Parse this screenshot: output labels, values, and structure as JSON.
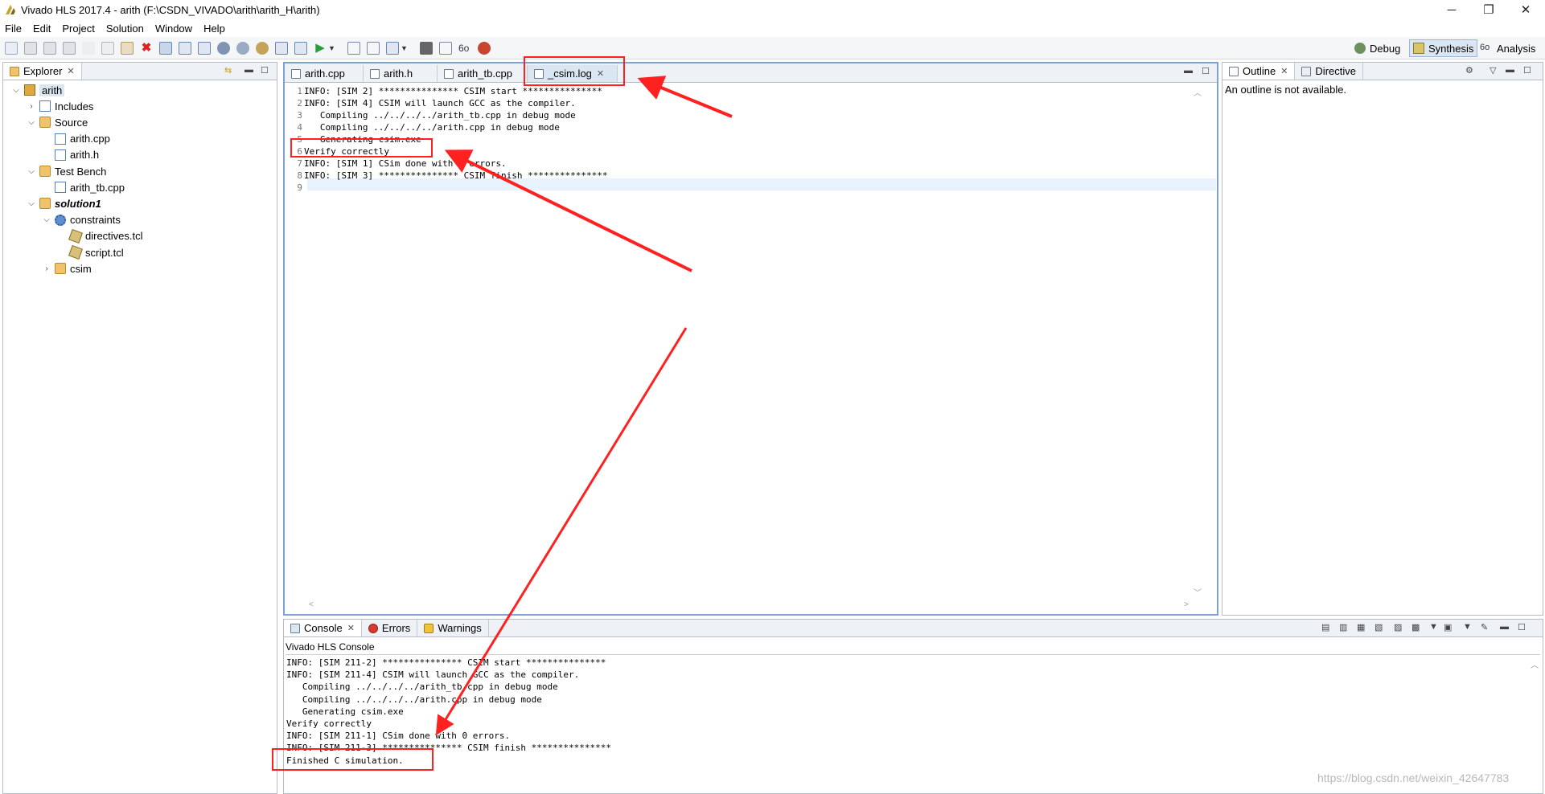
{
  "window": {
    "title": "Vivado HLS 2017.4 - arith (F:\\CSDN_VIVADO\\arith\\arith_H\\arith)",
    "controls": [
      "─",
      "❐",
      "✕"
    ]
  },
  "menu": [
    "File",
    "Edit",
    "Project",
    "Solution",
    "Window",
    "Help"
  ],
  "perspectives": [
    {
      "label": "Debug",
      "active": false
    },
    {
      "label": "Synthesis",
      "active": true
    },
    {
      "label": "Analysis",
      "active": false
    }
  ],
  "explorer": {
    "tab_label": "Explorer",
    "tree": [
      {
        "label": "arith",
        "level": 0,
        "twisty": "v",
        "icon": "project-icon"
      },
      {
        "label": "Includes",
        "level": 1,
        "twisty": ">",
        "icon": "includes-icon"
      },
      {
        "label": "Source",
        "level": 1,
        "twisty": "v",
        "icon": "source-folder-icon"
      },
      {
        "label": "arith.cpp",
        "level": 2,
        "twisty": "",
        "icon": "cpp-file-icon"
      },
      {
        "label": "arith.h",
        "level": 2,
        "twisty": "",
        "icon": "h-file-icon"
      },
      {
        "label": "Test Bench",
        "level": 1,
        "twisty": "v",
        "icon": "testbench-folder-icon"
      },
      {
        "label": "arith_tb.cpp",
        "level": 2,
        "twisty": "",
        "icon": "cpp-file-icon"
      },
      {
        "label": "solution1",
        "level": 1,
        "twisty": "v",
        "icon": "solution-folder-icon",
        "bold": true
      },
      {
        "label": "constraints",
        "level": 2,
        "twisty": "v",
        "icon": "constraints-gear-icon"
      },
      {
        "label": "directives.tcl",
        "level": 3,
        "twisty": "",
        "icon": "tcl-file-icon"
      },
      {
        "label": "script.tcl",
        "level": 3,
        "twisty": "",
        "icon": "tcl-file-icon"
      },
      {
        "label": "csim",
        "level": 2,
        "twisty": ">",
        "icon": "folder-icon"
      }
    ]
  },
  "editor": {
    "tabs": [
      {
        "label": "arith.cpp",
        "active": false
      },
      {
        "label": "arith.h",
        "active": false
      },
      {
        "label": "arith_tb.cpp",
        "active": false
      },
      {
        "label": "_csim.log",
        "active": true
      }
    ],
    "lines": [
      "INFO: [SIM 2] *************** CSIM start ***************",
      "INFO: [SIM 4] CSIM will launch GCC as the compiler.",
      "   Compiling ../../../../arith_tb.cpp in debug mode",
      "   Compiling ../../../../arith.cpp in debug mode",
      "   Generating csim.exe",
      "Verify correctly",
      "INFO: [SIM 1] CSim done with 0 errors.",
      "INFO: [SIM 3] *************** CSIM finish ***************",
      ""
    ],
    "line_numbers": [
      "1",
      "2",
      "3",
      "4",
      "5",
      "6",
      "7",
      "8",
      "9"
    ]
  },
  "outline": {
    "tabs": [
      "Outline",
      "Directive"
    ],
    "message": "An outline is not available."
  },
  "console": {
    "tabs": [
      "Console",
      "Errors",
      "Warnings"
    ],
    "header": "Vivado HLS Console",
    "lines": [
      "INFO: [SIM 211-2] *************** CSIM start ***************",
      "INFO: [SIM 211-4] CSIM will launch GCC as the compiler.",
      "   Compiling ../../../../arith_tb.cpp in debug mode",
      "   Compiling ../../../../arith.cpp in debug mode",
      "   Generating csim.exe",
      "Verify correctly",
      "INFO: [SIM 211-1] CSim done with 0 errors.",
      "INFO: [SIM 211-3] *************** CSIM finish ***************",
      "Finished C simulation."
    ]
  },
  "watermark": "https://blog.csdn.net/weixin_42647783",
  "colors": {
    "annotation_red": "#ff2020",
    "active_tab_bg": "#dbe6f3"
  }
}
